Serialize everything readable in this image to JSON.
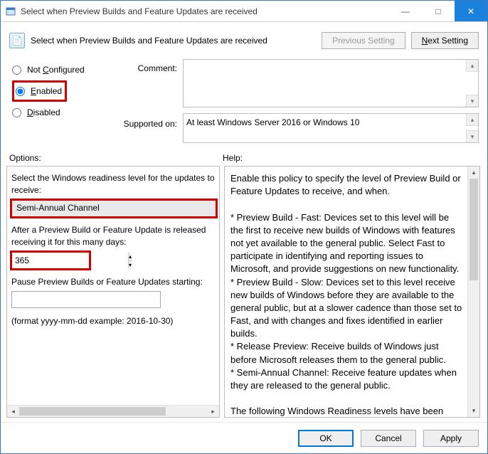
{
  "window": {
    "title": "Select when Preview Builds and Feature Updates are received"
  },
  "subheader": {
    "title": "Select when Preview Builds and Feature Updates are received",
    "previous_btn": "Previous Setting",
    "next_btn_prefix": "N",
    "next_btn_rest": "ext Setting"
  },
  "state_radios": {
    "not_configured": "Not Configured",
    "enabled": "Enabled",
    "disabled": "Disabled",
    "selected": "enabled",
    "not_configured_accel": "C",
    "enabled_accel": "E",
    "disabled_accel": "D"
  },
  "labels": {
    "comment": "Comment:",
    "supported": "Supported on:",
    "options": "Options:",
    "help": "Help:"
  },
  "comment_value": "",
  "supported_value": "At least Windows Server 2016 or Windows 10",
  "options": {
    "readiness_label": "Select the Windows readiness level for the updates to receive:",
    "readiness_value": "Semi-Annual Channel",
    "defer_label": "After a Preview Build or Feature Update is released receiving it for this many days:",
    "defer_value": "365",
    "pause_label": "Pause Preview Builds or Feature Updates starting:",
    "pause_value": "",
    "format_hint": "(format yyyy-mm-dd example: 2016-10-30)"
  },
  "help_text": "Enable this policy to specify the level of Preview Build or Feature Updates to receive, and when.\n\n* Preview Build - Fast: Devices set to this level will be the first to receive new builds of Windows with features not yet available to the general public. Select Fast to participate in identifying and reporting issues to Microsoft, and provide suggestions on new functionality.\n* Preview Build - Slow: Devices set to this level receive new builds of Windows before they are available to the general public, but at a slower cadence than those set to Fast, and with changes and fixes identified in earlier builds.\n* Release Preview: Receive builds of Windows just before Microsoft releases them to the general public.\n* Semi-Annual Channel: Receive feature updates when they are released to the general public.\n\nThe following Windows Readiness levels have been",
  "footer": {
    "ok": "OK",
    "cancel": "Cancel",
    "apply": "Apply"
  }
}
